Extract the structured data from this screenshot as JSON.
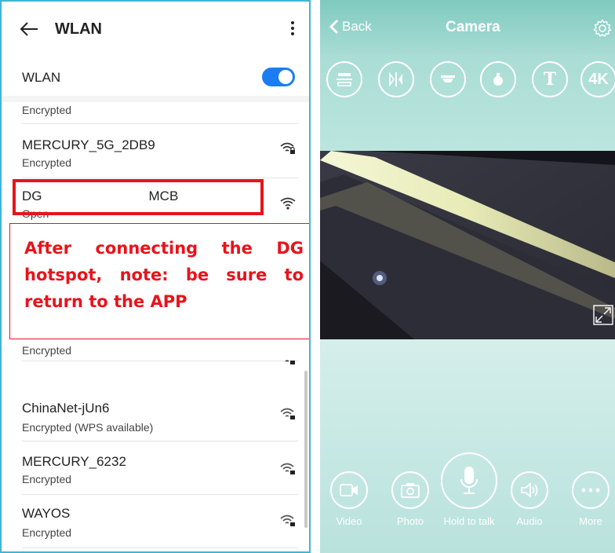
{
  "wlan_screen": {
    "title": "WLAN",
    "wlan_toggle_label": "WLAN",
    "wlan_enabled": true,
    "networks": [
      {
        "name": "",
        "status": "Encrypted"
      },
      {
        "name": "MERCURY_5G_2DB9",
        "status": "Encrypted"
      },
      {
        "name": "DG        MCB",
        "status": "Open"
      },
      {
        "name": "",
        "status": "Encrypted"
      },
      {
        "name": "ChinaNet-jUn6",
        "status": "Encrypted (WPS available)"
      },
      {
        "name": "MERCURY_6232",
        "status": "Encrypted"
      },
      {
        "name": "WAYOS",
        "status": "Encrypted"
      }
    ]
  },
  "annotation": {
    "note": "After connecting the DG hotspot, note: be sure to return to the APP",
    "color": "#e8131b"
  },
  "camera_screen": {
    "back_label": "Back",
    "title": "Camera",
    "tools": [
      {
        "icon": "flip-horizontal-icon"
      },
      {
        "icon": "mirror-icon"
      },
      {
        "icon": "ceiling-mount-icon"
      },
      {
        "icon": "light-icon"
      },
      {
        "icon": "text-t-icon",
        "label": "T"
      },
      {
        "icon": "resolution-4k-icon",
        "label": "4K"
      }
    ],
    "controls": {
      "video": "Video",
      "photo": "Photo",
      "hold_to_talk": "Hold to talk",
      "audio": "Audio",
      "more": "More"
    }
  }
}
